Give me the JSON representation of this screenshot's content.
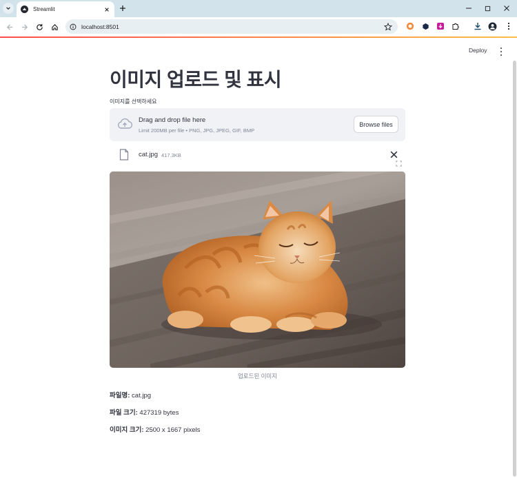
{
  "browser": {
    "tab_title": "Streamlit",
    "url": "localhost:8501"
  },
  "header": {
    "deploy_label": "Deploy"
  },
  "main": {
    "title": "이미지 업로드 및 표시",
    "uploader_label": "이미지를 선택하세요",
    "dropzone_text": "Drag and drop file here",
    "dropzone_limit": "Limit 200MB per file • PNG, JPG, JPEG, GIF, BMP",
    "browse_label": "Browse files",
    "file_name": "cat.jpg",
    "file_size": "417.3KB",
    "image_caption": "업로드된 이미지",
    "info": {
      "name_label": "파일명:",
      "name_value": "cat.jpg",
      "size_label": "파일 크기:",
      "size_value": "427319 bytes",
      "dims_label": "이미지 크기:",
      "dims_value": "2500 x 1667 pixels"
    }
  },
  "icons": {
    "tab_list": "chevron-down-icon",
    "favicon": "streamlit-icon",
    "close": "close-icon",
    "new_tab": "plus-icon",
    "back": "arrow-left-icon",
    "forward": "arrow-right-icon",
    "reload": "reload-icon",
    "home": "home-icon",
    "site_info": "info-icon",
    "bookmark": "star-icon",
    "upload": "cloud-upload-icon",
    "file": "file-icon",
    "fullscreen": "fullscreen-icon",
    "menu": "more-vert-icon"
  },
  "colors": {
    "accent": "#ff4b4b",
    "dropzone_bg": "#f0f2f6",
    "text": "#31333f",
    "muted": "#808495"
  }
}
